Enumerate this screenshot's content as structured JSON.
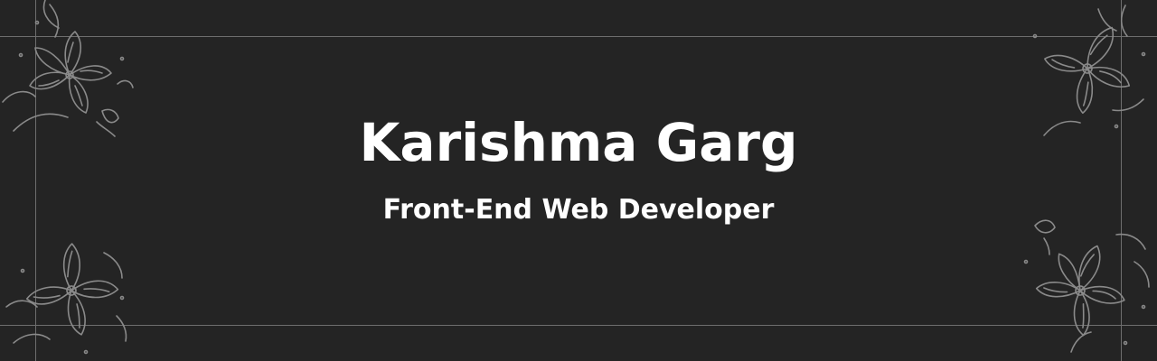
{
  "banner": {
    "name": "Karishma Garg",
    "role": "Front-End Web Developer"
  },
  "colors": {
    "background": "#242424",
    "text": "#ffffff",
    "guide_lines": "#6e6e6e",
    "ornament": "#8a8a8a"
  },
  "icons": {
    "top_left": "floral-ornament-icon",
    "top_right": "floral-ornament-icon",
    "bottom_left": "floral-ornament-icon",
    "bottom_right": "floral-ornament-icon"
  }
}
